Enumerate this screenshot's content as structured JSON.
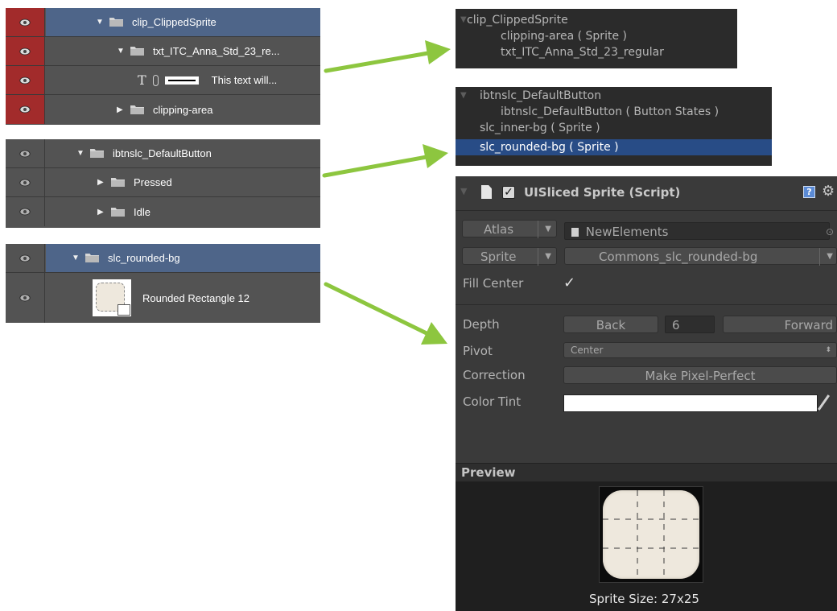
{
  "ps_panel_1": {
    "rows": [
      {
        "label": "clip_ClippedSprite"
      },
      {
        "label": "txt_ITC_Anna_Std_23_re..."
      },
      {
        "label": "This text will...",
        "type_glyph": "T"
      },
      {
        "label": "clipping-area"
      }
    ]
  },
  "ps_panel_2": {
    "rows": [
      {
        "label": "ibtnslc_DefaultButton"
      },
      {
        "label": "Pressed"
      },
      {
        "label": "Idle"
      }
    ]
  },
  "ps_panel_3": {
    "rows": [
      {
        "label": "slc_rounded-bg"
      },
      {
        "label": "Rounded Rectangle 12"
      }
    ]
  },
  "unity_hierarchy_1": {
    "rows": [
      {
        "label": "clip_ClippedSprite"
      },
      {
        "label": "clipping-area ( Sprite )"
      },
      {
        "label": "txt_ITC_Anna_Std_23_regular"
      }
    ]
  },
  "unity_hierarchy_2": {
    "rows": [
      {
        "label": "ibtnslc_DefaultButton"
      },
      {
        "label": "ibtnslc_DefaultButton ( Button States )"
      },
      {
        "label": "slc_inner-bg ( Sprite )"
      },
      {
        "label": "slc_rounded-bg ( Sprite )"
      }
    ]
  },
  "inspector": {
    "component_title": "UISliced Sprite (Script)",
    "atlas_label": "Atlas",
    "atlas_value": "NewElements",
    "sprite_label": "Sprite",
    "sprite_value": "Commons_slc_rounded-bg",
    "fill_center_label": "Fill Center",
    "depth_label": "Depth",
    "depth_back": "Back",
    "depth_value": "6",
    "depth_forward": "Forward",
    "pivot_label": "Pivot",
    "pivot_value": "Center",
    "correction_label": "Correction",
    "make_pixel_perfect": "Make Pixel-Perfect",
    "color_tint_label": "Color Tint",
    "color_tint": "#ffffff",
    "preview_label": "Preview",
    "sprite_size": "Sprite Size: 27x25",
    "sprite_color": "#eee8dd"
  },
  "colors": {
    "arrow": "#8dc63f",
    "ps_selection": "#4e6589",
    "unity_selection": "#284c86",
    "visibility_red": "#a22b2b"
  },
  "icons": [
    "eye-icon",
    "folder-icon",
    "disclosure-triangle-icon",
    "text-layer-icon",
    "link-icon",
    "shape-layer-icon",
    "checkbox-icon",
    "script-icon",
    "help-icon",
    "gear-icon",
    "dropdown-arrow-icon",
    "eyedropper-icon"
  ]
}
